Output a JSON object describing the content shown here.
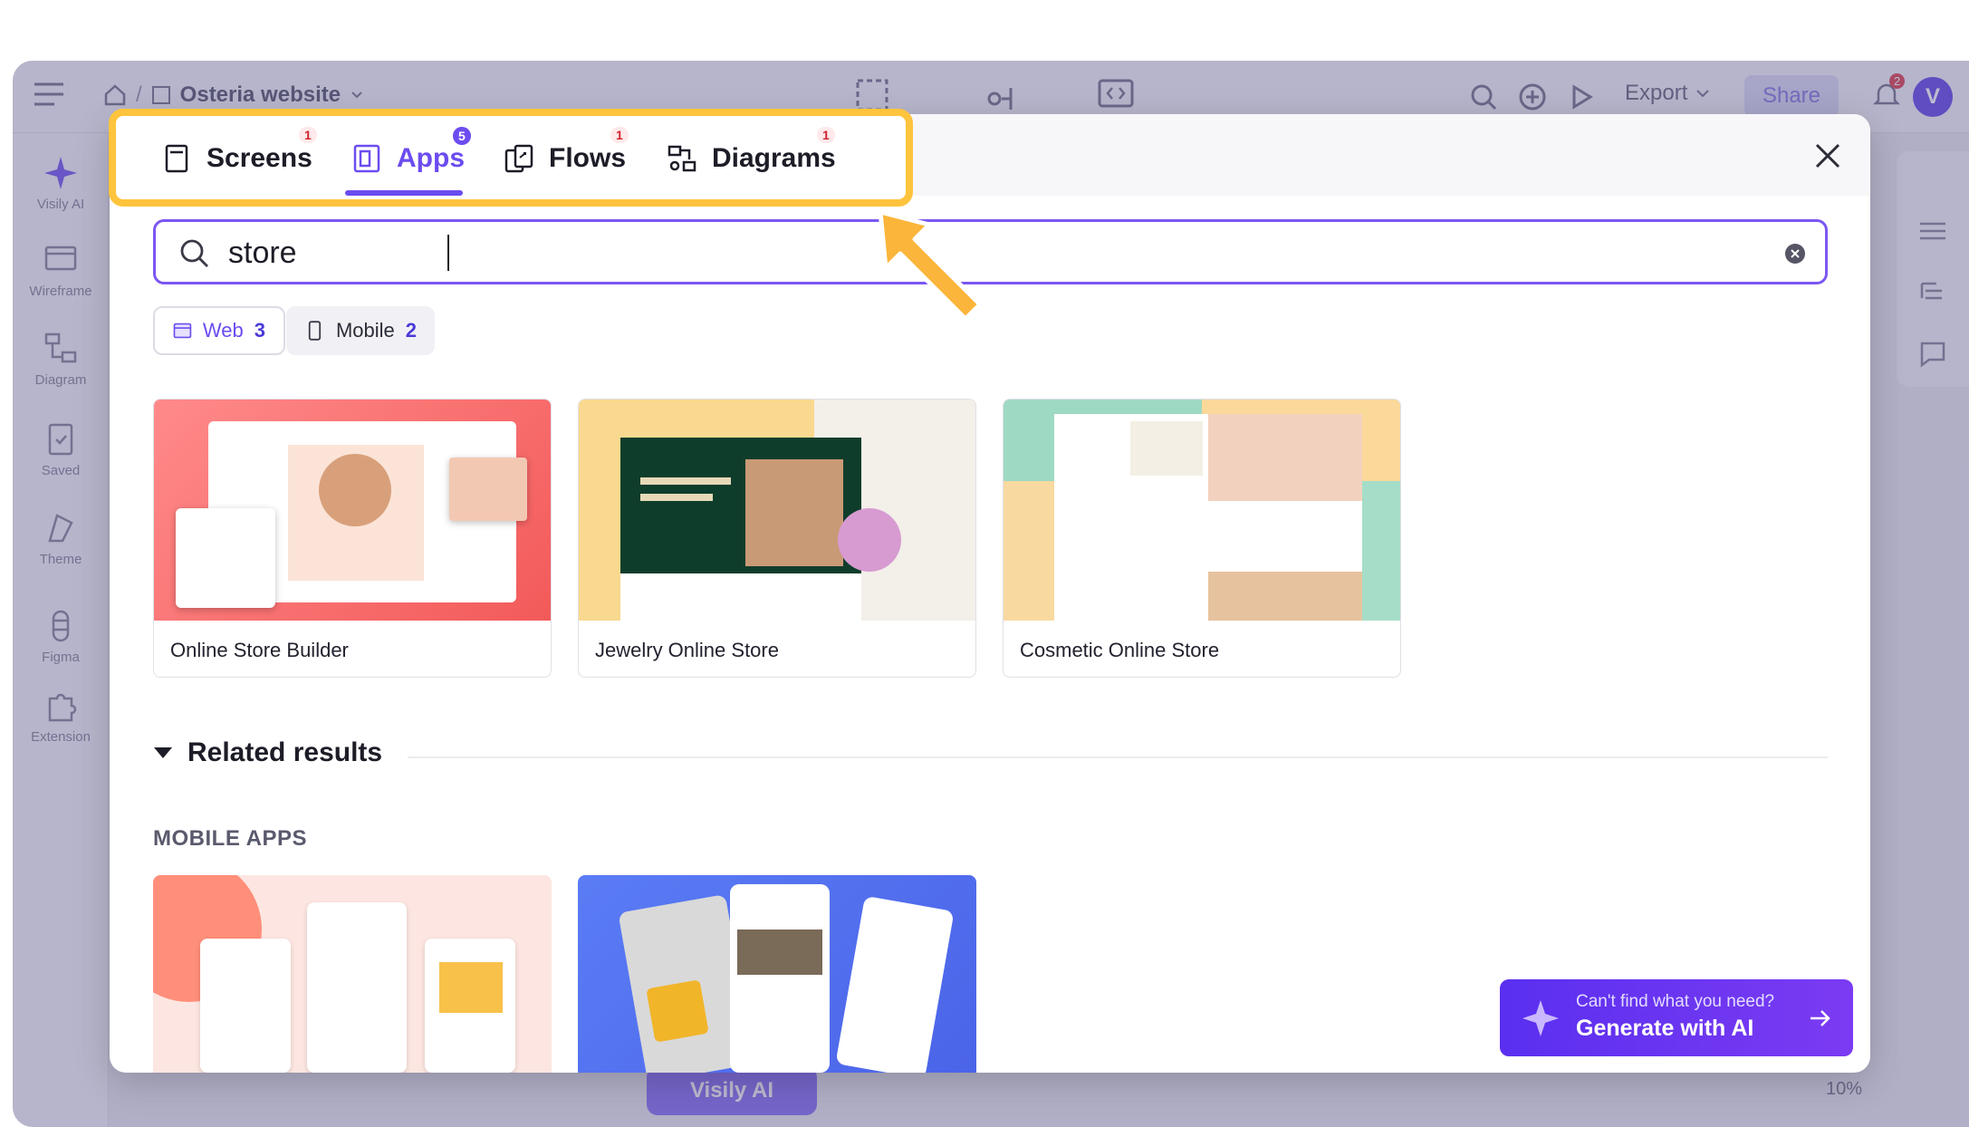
{
  "app": {
    "breadcrumb_project": "Osteria website",
    "export_label": "Export",
    "share_label": "Share",
    "notification_count": "2",
    "avatar_letter": "V",
    "zoom_level": "10%",
    "visily_ai_label": "Visily AI"
  },
  "left_rail": [
    {
      "label": "Visily AI",
      "icon": "sparkle-icon"
    },
    {
      "label": "Wireframe",
      "icon": "wireframe-icon"
    },
    {
      "label": "Diagram",
      "icon": "diagram-icon"
    },
    {
      "label": "Saved",
      "icon": "saved-icon"
    },
    {
      "label": "Theme",
      "icon": "theme-icon"
    },
    {
      "label": "Figma",
      "icon": "figma-icon"
    },
    {
      "label": "Extension",
      "icon": "extension-icon"
    }
  ],
  "tabs": [
    {
      "label": "Screens",
      "badge": "1",
      "active": false
    },
    {
      "label": "Apps",
      "badge": "5",
      "active": true
    },
    {
      "label": "Flows",
      "badge": "1",
      "active": false
    },
    {
      "label": "Diagrams",
      "badge": "1",
      "active": false
    }
  ],
  "search": {
    "value": "store"
  },
  "filters": [
    {
      "label": "Web",
      "count": "3",
      "active": true
    },
    {
      "label": "Mobile",
      "count": "2",
      "active": false
    }
  ],
  "cards": [
    {
      "title": "Online Store Builder"
    },
    {
      "title": "Jewelry Online Store"
    },
    {
      "title": "Cosmetic Online Store"
    }
  ],
  "related": {
    "title": "Related results",
    "section": "MOBILE APPS"
  },
  "ai_cta": {
    "subtitle": "Can't find what you need?",
    "title": "Generate with AI"
  },
  "colors": {
    "accent": "#6c4cf0",
    "highlight": "#ffc43d",
    "badge_red": "#d0242f"
  }
}
